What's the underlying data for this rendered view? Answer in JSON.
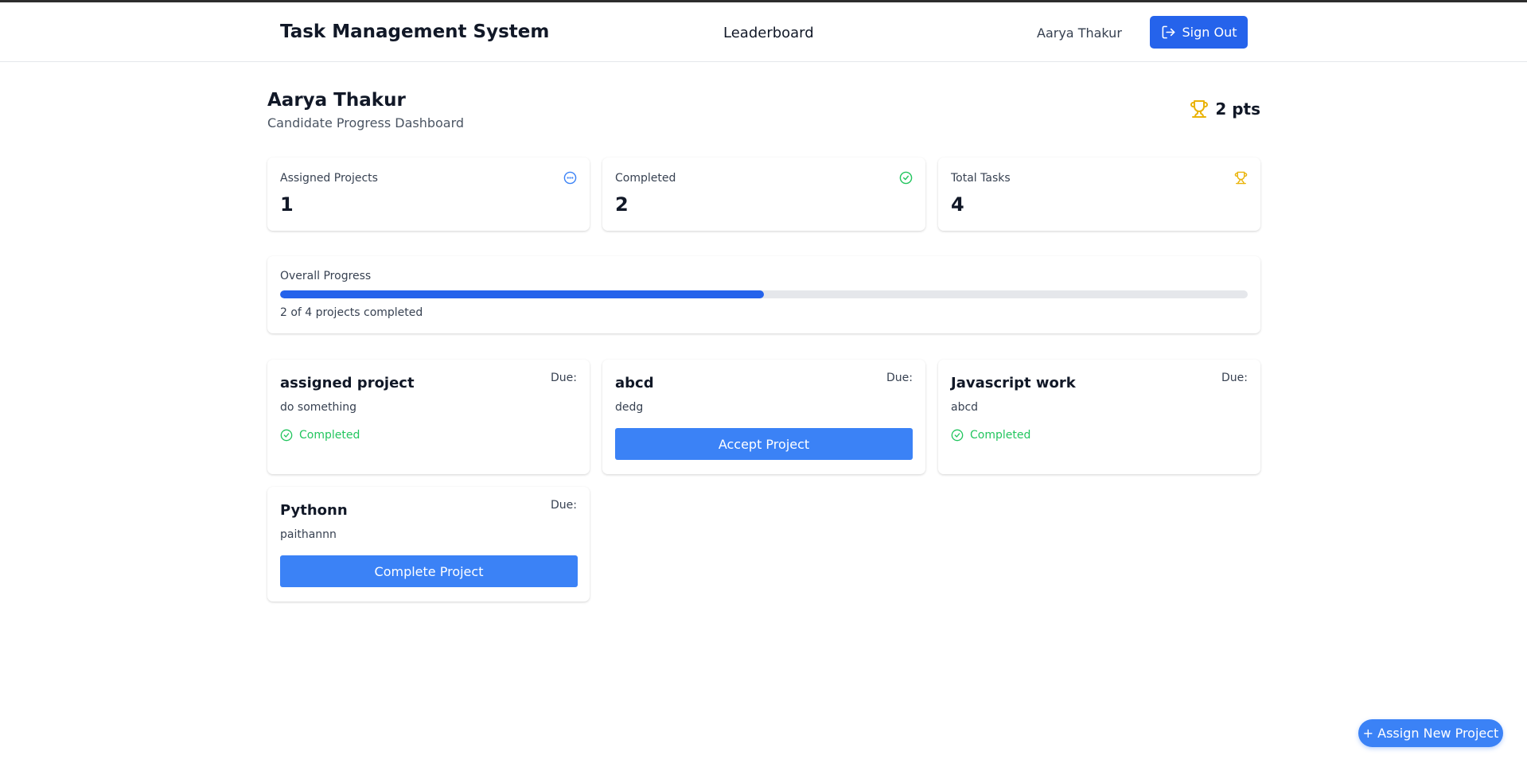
{
  "nav": {
    "brand": "Task Management System",
    "leaderboard": "Leaderboard",
    "user_name": "Aarya Thakur",
    "sign_out": "Sign Out"
  },
  "header": {
    "title": "Aarya Thakur",
    "subtitle": "Candidate Progress Dashboard",
    "points": "2 pts"
  },
  "stats": [
    {
      "label": "Assigned Projects",
      "value": "1",
      "icon": "clock-icon",
      "color": "#3b82f6"
    },
    {
      "label": "Completed",
      "value": "2",
      "icon": "check-circle-icon",
      "color": "#22c55e"
    },
    {
      "label": "Total Tasks",
      "value": "4",
      "icon": "trophy-icon",
      "color": "#eab308"
    }
  ],
  "progress": {
    "label": "Overall Progress",
    "fraction": 0.5,
    "text": "2 of 4 projects completed"
  },
  "projects": [
    {
      "title": "assigned project",
      "due": "Due:",
      "description": "do something",
      "status": "Completed"
    },
    {
      "title": "abcd",
      "due": "Due:",
      "description": "dedg",
      "action": "Accept Project"
    },
    {
      "title": "Javascript work",
      "due": "Due:",
      "description": "abcd",
      "status": "Completed"
    },
    {
      "title": "Pythonn",
      "due": "Due:",
      "description": "paithannn",
      "action": "Complete Project"
    }
  ],
  "fab_label": "+ Assign New Project",
  "colors": {
    "primary": "#2563eb",
    "button": "#3b82f6",
    "success": "#22c55e",
    "trophy": "#eab308"
  }
}
